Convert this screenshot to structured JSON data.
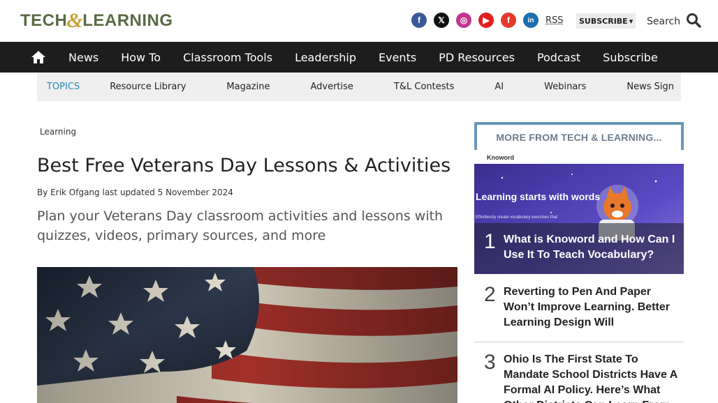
{
  "header": {
    "logo_part1": "TECH",
    "logo_amp": "&",
    "logo_part2": "LEARNING",
    "social": {
      "facebook": "f",
      "x": "𝕏",
      "instagram": "◎",
      "youtube": "▶",
      "flipboard": "f",
      "linkedin": "in"
    },
    "rss": "RSS",
    "subscribe": "SUBSCRIBE",
    "subscribe_arrow": "▾",
    "search_label": "Search"
  },
  "nav": {
    "items": [
      "News",
      "How To",
      "Classroom Tools",
      "Leadership",
      "Events",
      "PD Resources",
      "Podcast",
      "Subscribe"
    ]
  },
  "topics": {
    "label": "TOPICS",
    "items": [
      "Resource Library",
      "Magazine",
      "Advertise",
      "T&L Contests",
      "AI",
      "Webinars",
      "News Sign"
    ]
  },
  "article": {
    "breadcrumb": "Learning",
    "title": "Best Free Veterans Day Lessons & Activities",
    "byline_by": "By",
    "author": "Erik Ofgang",
    "updated": "last updated 5 November 2024",
    "standfirst": "Plan your Veterans Day classroom activities and lessons with quizzes, videos, primary sources, and more"
  },
  "sidebar": {
    "title": "MORE FROM TECH & LEARNING...",
    "feature_image_text": {
      "brand": "Knoword",
      "headline": "Learning starts with words",
      "sub": "Effortlessly create vocabulary exercises that"
    },
    "items": [
      {
        "rank": "1",
        "title": "What is Knoword and How Can I Use It To Teach Vocabulary?"
      },
      {
        "rank": "2",
        "title": "Reverting to Pen And Paper Won’t Improve Learning. Better Learning Design Will"
      },
      {
        "rank": "3",
        "title": "Ohio Is The First State To Mandate School Districts Have A Formal AI Policy. Here’s What Other Districts Can Learn From"
      }
    ]
  },
  "colors": {
    "nav_bg": "#1d1d1d",
    "topics_label": "#2a8ab8",
    "sidebar_border": "#6a97b8",
    "logo_green": "#5a6b44",
    "logo_gold": "#c9a23a"
  }
}
